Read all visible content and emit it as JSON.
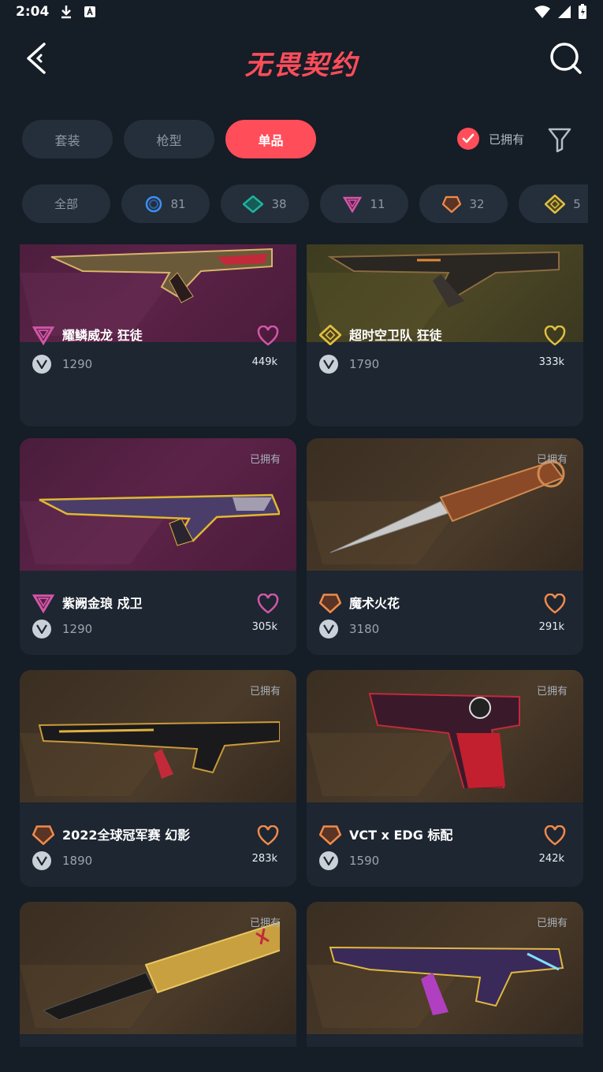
{
  "status": {
    "time": "2:04"
  },
  "header": {
    "logo_text": "无畏契约"
  },
  "tabs": [
    {
      "label": "套装",
      "active": false
    },
    {
      "label": "枪型",
      "active": false
    },
    {
      "label": "单品",
      "active": true
    }
  ],
  "owned_filter": {
    "label": "已拥有",
    "checked": true
  },
  "rarities": [
    {
      "label": "全部",
      "icon": "all"
    },
    {
      "label": "81",
      "icon": "select-tier-icon",
      "color": "#3d8ff5"
    },
    {
      "label": "38",
      "icon": "deluxe-tier-icon",
      "color": "#20b2a0"
    },
    {
      "label": "11",
      "icon": "premium-tier-icon",
      "color": "#d257a8"
    },
    {
      "label": "32",
      "icon": "exclusive-tier-icon",
      "color": "#f08a4b"
    },
    {
      "label": "5",
      "icon": "ultra-tier-icon",
      "color": "#e0c040"
    }
  ],
  "cards": [
    {
      "name": "耀鳞威龙 狂徒",
      "price": "1290",
      "likes": "449k",
      "owned_tag": "",
      "tier_color": "#d257a8",
      "bg": "purple"
    },
    {
      "name": "超时空卫队 狂徒",
      "price": "1790",
      "likes": "333k",
      "owned_tag": "",
      "tier_color": "#e0c040",
      "bg": "olive"
    },
    {
      "name": "紫阙金琅 戍卫",
      "price": "1290",
      "likes": "305k",
      "owned_tag": "已拥有",
      "tier_color": "#d257a8",
      "bg": "purple"
    },
    {
      "name": "魔术火花",
      "price": "3180",
      "likes": "291k",
      "owned_tag": "已拥有",
      "tier_color": "#f08a4b",
      "bg": "brown"
    },
    {
      "name": "2022全球冠军赛 幻影",
      "price": "1890",
      "likes": "283k",
      "owned_tag": "已拥有",
      "tier_color": "#f08a4b",
      "bg": "brown"
    },
    {
      "name": "VCT x EDG 标配",
      "price": "1590",
      "likes": "242k",
      "owned_tag": "已拥有",
      "tier_color": "#f08a4b",
      "bg": "brown"
    },
    {
      "name": "",
      "price": "",
      "likes": "",
      "owned_tag": "已拥有",
      "tier_color": "#f08a4b",
      "bg": "brown"
    },
    {
      "name": "",
      "price": "",
      "likes": "",
      "owned_tag": "已拥有",
      "tier_color": "#f08a4b",
      "bg": "brown"
    }
  ]
}
